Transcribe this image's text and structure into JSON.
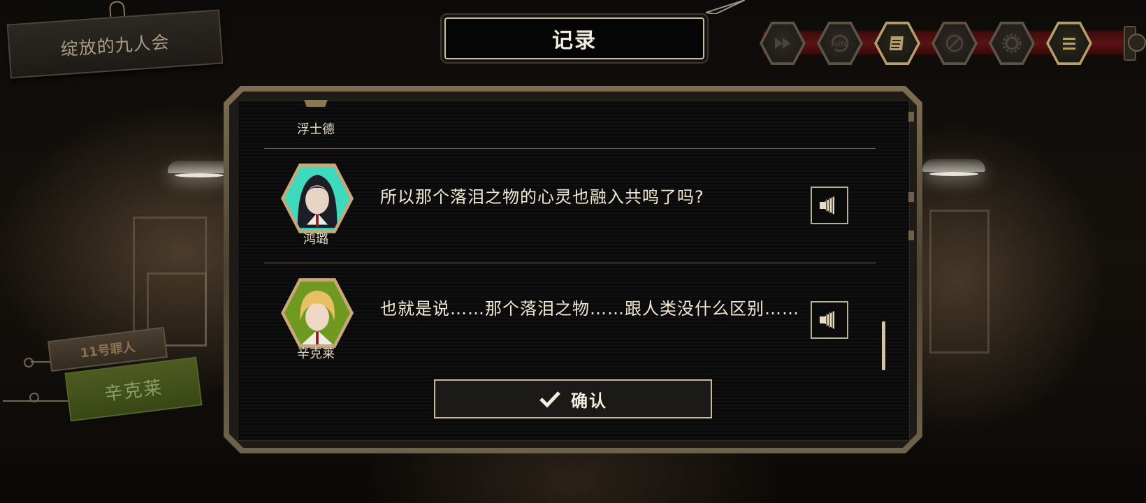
{
  "chapter": {
    "title": "绽放的九人会"
  },
  "dialog_log": {
    "title": "记录",
    "entries": [
      {
        "speaker": "浮士德",
        "text": "",
        "has_voice": false,
        "avatar_color": "#8a7752"
      },
      {
        "speaker": "鸿璐",
        "text": "所以那个落泪之物的心灵也融入共鸣了吗?",
        "has_voice": true,
        "avatar_color": "#3fd9be"
      },
      {
        "speaker": "辛克莱",
        "text": "也就是说……那个落泪之物……跟人类没什么区别……",
        "has_voice": true,
        "avatar_color": "#6f9a1f"
      }
    ],
    "confirm_label": "确认"
  },
  "toolbar": {
    "buttons": [
      {
        "icon": "fast-forward-icon",
        "label": ""
      },
      {
        "icon": "auto-icon",
        "label": "AUTO"
      },
      {
        "icon": "log-icon",
        "label": ""
      },
      {
        "icon": "hide-ui-icon",
        "label": ""
      },
      {
        "icon": "settings-gear-icon",
        "label": ""
      },
      {
        "icon": "menu-icon",
        "label": ""
      }
    ],
    "active_index": 2,
    "accent": "#b4a069",
    "rail_color": "#5b1214"
  },
  "speaker_tag": {
    "sinner_label": "11号罪人",
    "name": "辛克莱",
    "name_color": "#4d5b20"
  }
}
